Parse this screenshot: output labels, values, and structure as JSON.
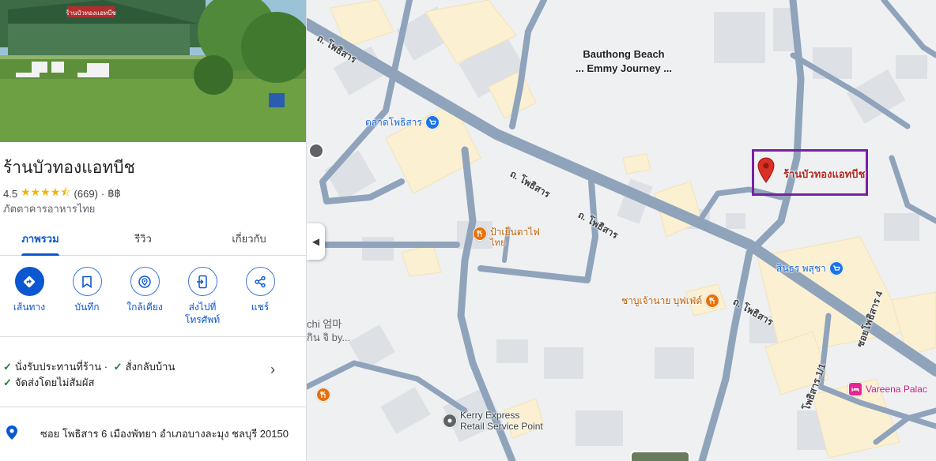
{
  "place": {
    "name": "ร้านบัวทองแอทบีช",
    "rating": "4.5",
    "stars": "★★★★⯪",
    "reviews": "(669)",
    "separator": "·",
    "price": "฿฿",
    "category": "ภัตตาคารอาหารไทย",
    "sign_text": "ร้านบัวทองแอทบีช"
  },
  "tabs": [
    {
      "label": "ภาพรวม",
      "active": true
    },
    {
      "label": "รีวิว",
      "active": false
    },
    {
      "label": "เกี่ยวกับ",
      "active": false
    }
  ],
  "actions": [
    {
      "label": "เส้นทาง",
      "icon": "directions-icon"
    },
    {
      "label": "บันทึก",
      "icon": "bookmark-icon"
    },
    {
      "label": "ใกล้เคียง",
      "icon": "nearby-icon"
    },
    {
      "label": "ส่งไปที่โทรศัพท์",
      "icon": "send-to-phone-icon"
    },
    {
      "label": "แชร์",
      "icon": "share-icon"
    }
  ],
  "services": {
    "dine_in": "นั่งรับประทานที่ร้าน ·",
    "takeout": "สั่งกลับบ้าน",
    "no_contact_delivery": "จัดส่งโดยไม่สัมผัส"
  },
  "address": "ซอย โพธิสาร 6 เมืองพัทยา อำเภอบางละมุง ชลบุรี 20150",
  "map": {
    "roads": [
      "ถ. โพธิสาร",
      "ถ. โพธิสาร",
      "ถ. โพธิสาร",
      "ถ. โพธิสาร",
      "ซอยโพธิสาร 4",
      "โพธิสาร 1/1"
    ],
    "area_label_1": "Bauthong Beach",
    "area_label_2": "... Emmy Journey ...",
    "pois": {
      "market": "ตลาดโพธิสาร",
      "restaurant_1_line1": "ป้าเย็นตาไฟ",
      "restaurant_1_line2": "ไทย",
      "restaurant_2": "ชาบูเจ้านาย บุฟเฟ่ต์",
      "store": "สินธร พสุชา",
      "hotel": "Vareena Palac",
      "kerry_line1": "Kerry Express",
      "kerry_line2": "Retail Service Point",
      "partial_line1": "chi 엄마",
      "partial_line2": "กิน จิ by..."
    },
    "selected_pin_label": "ร้านบัวทองแอทบีช"
  },
  "colors": {
    "accent": "#0b57d0",
    "highlight_box": "#7b1fa2",
    "pin": "#d93025",
    "road": "#8fa3bb",
    "building": "#fbf0d2"
  }
}
